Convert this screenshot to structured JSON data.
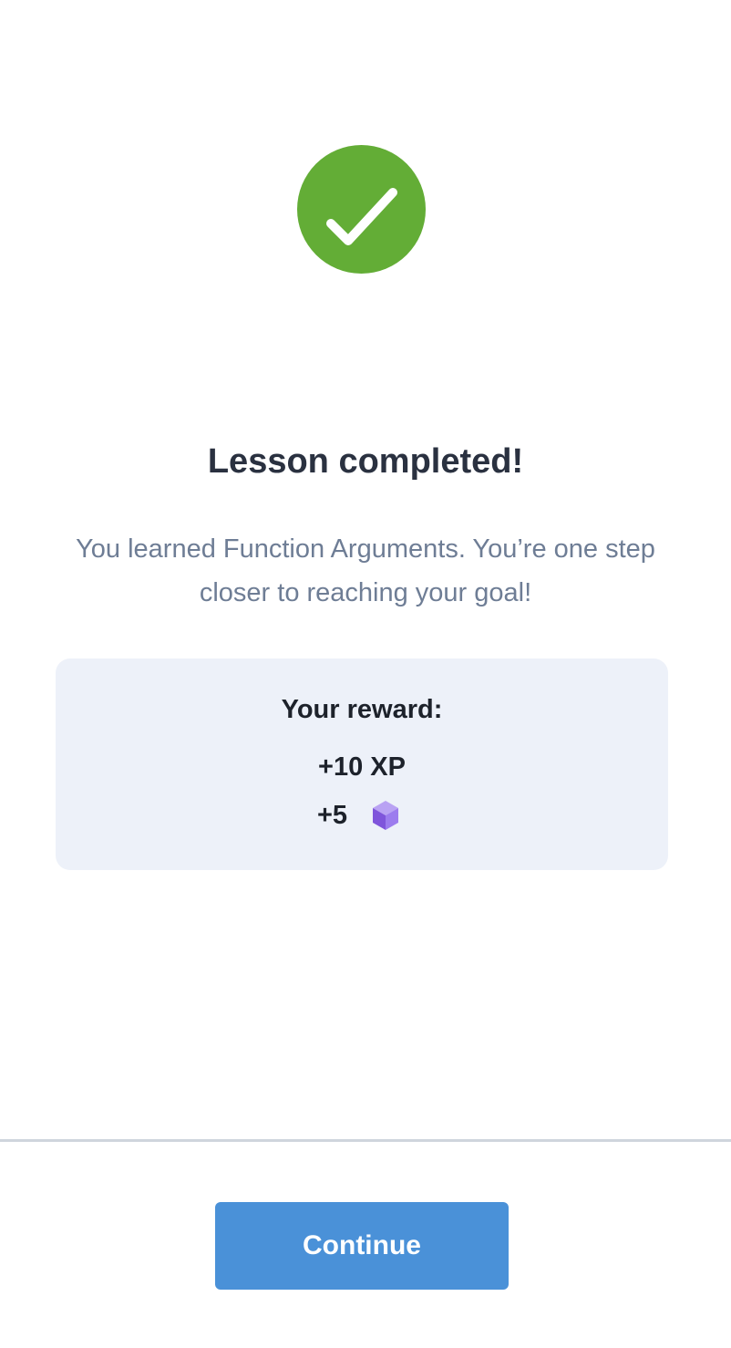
{
  "success_icon": {
    "name": "checkmark-icon",
    "color": "#63ad36"
  },
  "title": "Lesson completed!",
  "subtitle": "You learned Function Arguments. You’re one step closer to reaching your goal!",
  "reward": {
    "heading": "Your reward:",
    "xp": "+10 XP",
    "bits_amount": "+5",
    "bits_icon": "cube-icon"
  },
  "footer": {
    "continue_label": "Continue",
    "accent_color": "#4a91d8"
  }
}
